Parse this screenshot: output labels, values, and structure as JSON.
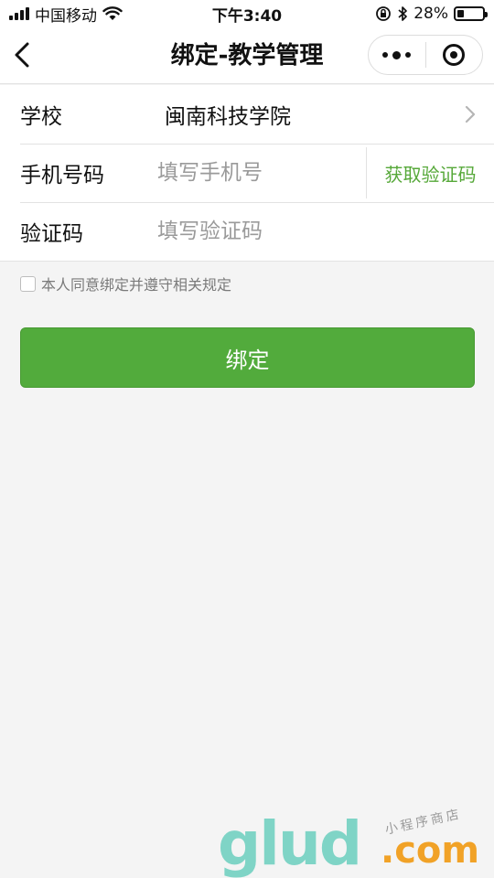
{
  "status_bar": {
    "carrier": "中国移动",
    "time": "下午3:40",
    "battery_percent": "28%",
    "battery_level": 0.28,
    "icons": [
      "signal-icon",
      "wifi-icon",
      "orientation-lock-icon",
      "bluetooth-icon",
      "battery-icon"
    ]
  },
  "nav": {
    "title": "绑定-教学管理",
    "icons": [
      "back-arrow-icon",
      "more-dots-icon",
      "close-target-icon"
    ]
  },
  "form": {
    "school_label": "学校",
    "school_value": "闽南科技学院",
    "phone_label": "手机号码",
    "phone_placeholder": "填写手机号",
    "phone_value": "",
    "get_code_label": "获取验证码",
    "code_label": "验证码",
    "code_placeholder": "填写验证码",
    "code_value": ""
  },
  "agreement": {
    "text": "本人同意绑定并遵守相关规定",
    "checked": false
  },
  "bind_button": {
    "label": "绑定"
  },
  "watermark": {
    "logo": "glud",
    "suffix": ".com",
    "tagline": "小程序商店"
  },
  "colors": {
    "accent_green": "#52ab3c",
    "link_green": "#56a839",
    "background": "#f4f4f4"
  }
}
